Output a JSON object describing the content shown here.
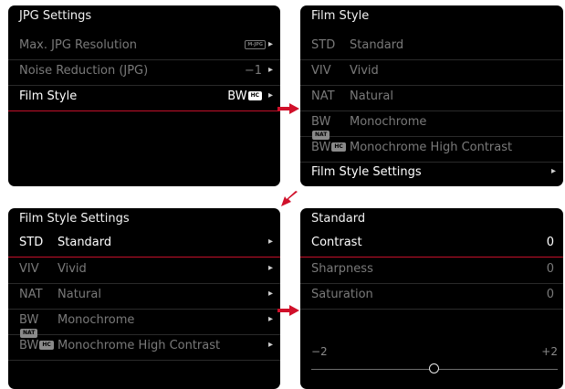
{
  "panel1": {
    "title": "JPG Settings",
    "rows": [
      {
        "label": "Max. JPG Resolution",
        "badge": "M-JPG"
      },
      {
        "label": "Noise Reduction (JPG)",
        "value": "−1"
      },
      {
        "label": "Film Style",
        "value": "BW",
        "badge": "HC"
      }
    ]
  },
  "panel2": {
    "title": "Film Style",
    "items": [
      {
        "abbr": "STD",
        "name": "Standard"
      },
      {
        "abbr": "VIV",
        "name": "Vivid"
      },
      {
        "abbr": "NAT",
        "name": "Natural"
      },
      {
        "abbr": "BW",
        "badge": "NAT",
        "name": "Monochrome"
      },
      {
        "abbr": "BW",
        "badge": "HC",
        "name": "Monochrome High Contrast"
      }
    ],
    "settings_label": "Film Style Settings"
  },
  "panel3": {
    "title": "Film Style Settings",
    "items": [
      {
        "abbr": "STD",
        "name": "Standard"
      },
      {
        "abbr": "VIV",
        "name": "Vivid"
      },
      {
        "abbr": "NAT",
        "name": "Natural"
      },
      {
        "abbr": "BW",
        "badge": "NAT",
        "name": "Monochrome"
      },
      {
        "abbr": "BW",
        "badge": "HC",
        "name": "Monochrome High Contrast"
      }
    ]
  },
  "panel4": {
    "title": "Standard",
    "rows": [
      {
        "label": "Contrast",
        "value": "0"
      },
      {
        "label": "Sharpness",
        "value": "0"
      },
      {
        "label": "Saturation",
        "value": "0"
      }
    ],
    "slider": {
      "min_label": "−2",
      "max_label": "+2",
      "value": 0,
      "min": -2,
      "max": 2
    }
  },
  "colors": {
    "accent_red": "#c4102a",
    "panel_bg": "#000000"
  },
  "icons": {
    "chevron": "chevron-right-icon",
    "arrow": "red-arrow-icon"
  }
}
